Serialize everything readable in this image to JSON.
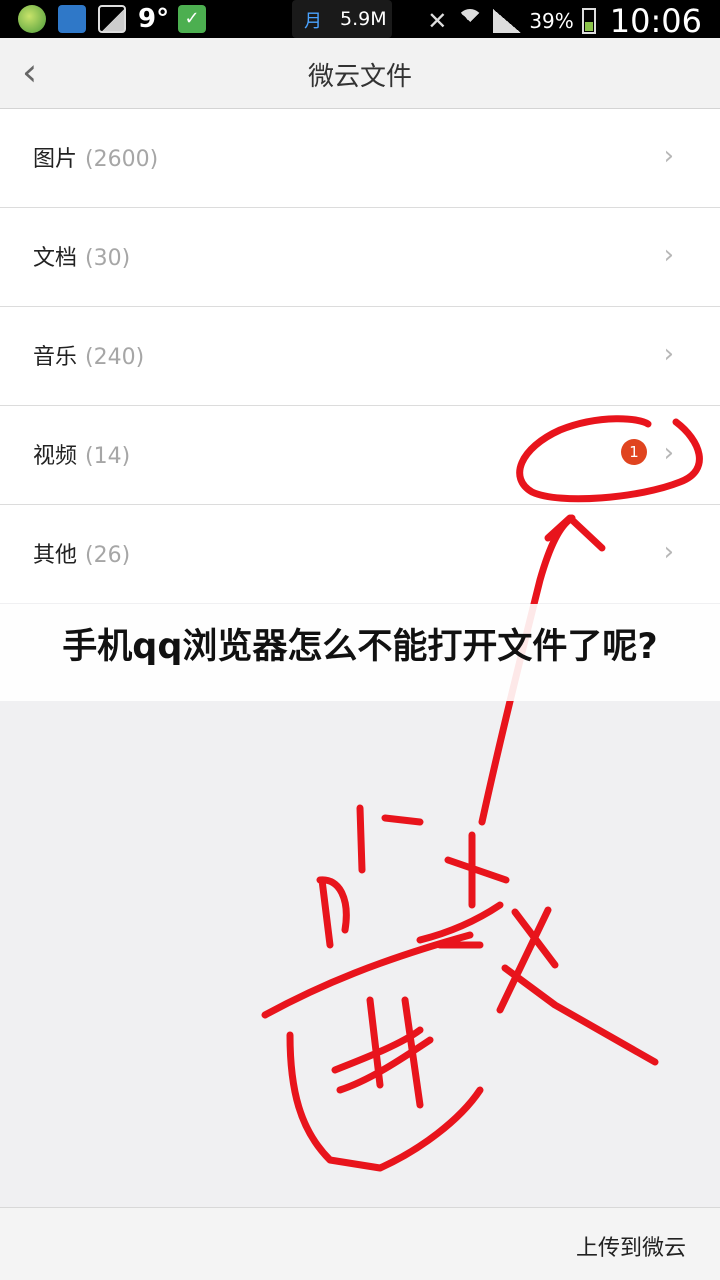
{
  "status_bar": {
    "temperature": "9°",
    "moon_glyph": "月",
    "speed": "5.9M",
    "battery_pct": "39%",
    "time": "10:06"
  },
  "header": {
    "back_glyph": "‹",
    "title": "微云文件"
  },
  "list": {
    "items": [
      {
        "label": "图片",
        "count": "(2600)"
      },
      {
        "label": "文档",
        "count": "(30)"
      },
      {
        "label": "音乐",
        "count": "(240)"
      },
      {
        "label": "视频",
        "count": "(14)",
        "badge": "1"
      },
      {
        "label": "其他",
        "count": "(26)"
      }
    ],
    "chevron_glyph": "›"
  },
  "caption": {
    "text": "手机qq浏览器怎么不能打开文件了呢?"
  },
  "footer": {
    "upload_label": "上传到微云"
  },
  "colors": {
    "annotation_red": "#e8141c",
    "badge_red": "#e0441f"
  },
  "icons": [
    "chat-app-icon",
    "cloud-app-icon",
    "gallery-icon",
    "check-icon",
    "mute-icon",
    "wifi-icon",
    "signal-icon",
    "battery-icon",
    "back-icon",
    "chevron-right-icon"
  ]
}
